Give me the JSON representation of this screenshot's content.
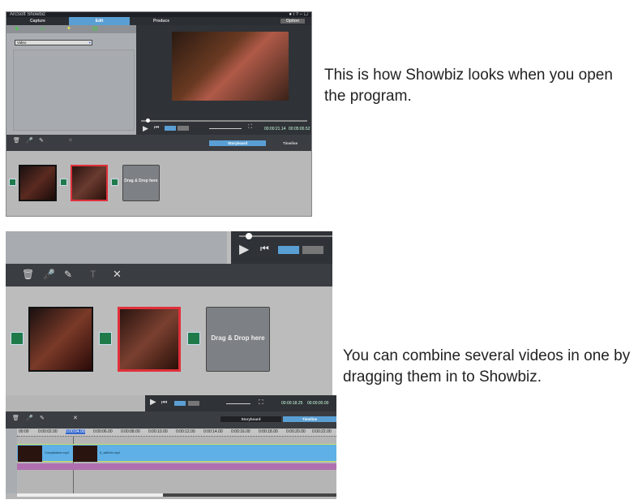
{
  "captions": [
    "This is how Showbiz looks when you open the program.",
    "You can combine several videos in one by dragging them in to Showbiz."
  ],
  "app": {
    "title": "ArcSoft Showbiz",
    "tabs": [
      "Capture",
      "Edit",
      "Produce"
    ],
    "active_tab": "Edit",
    "option_label": "Option",
    "media_dropdown": "Video",
    "view_tabs": [
      "Storyboard",
      "Timeline"
    ],
    "drop_zone": "Drag & Drop here",
    "timecode": "00:00:21.14",
    "duration": "00:05:00.52",
    "timecode2": "00:00:18.25",
    "duration2": "00:00:00.00"
  },
  "timeline": {
    "ruler": [
      "00:00",
      "0:00:02.00",
      "0:00:04.00",
      "0:00:06.00",
      "0:00:08.00",
      "0:00:10.00",
      "0:00:12.00",
      "0:00:14.00",
      "0:00:16.00",
      "0:00:18.00",
      "0:00:20.00",
      "0:00:22.00"
    ],
    "clips": [
      "Compilation.mp4",
      "6_wikiHo.mp4"
    ]
  },
  "colors": {
    "accent": "#5a9fd4",
    "selected": "#e0303a",
    "connector": "#1f7a4a",
    "audio": "#b070b0"
  }
}
